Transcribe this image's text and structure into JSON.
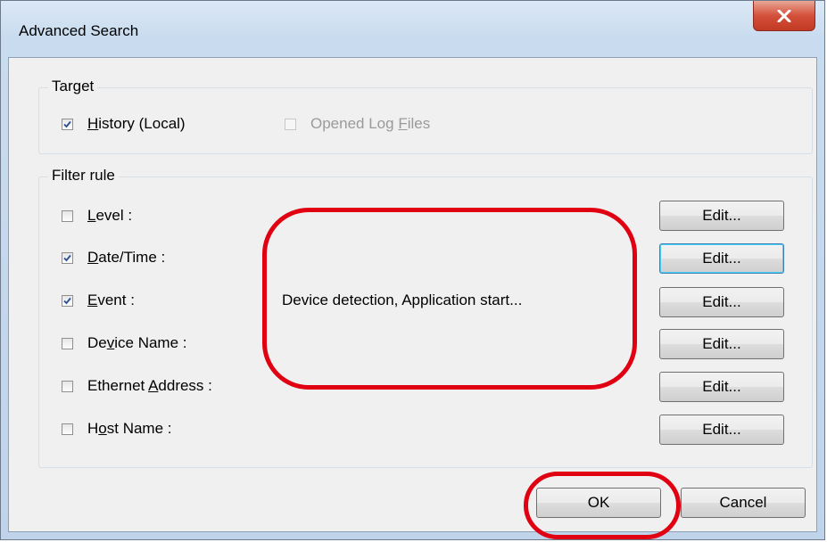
{
  "window": {
    "title": "Advanced Search"
  },
  "target": {
    "legend": "Target",
    "history": {
      "label_prefix": "",
      "label_key": "H",
      "label_suffix": "istory (Local)",
      "checked": true
    },
    "opened_logs": {
      "label_prefix": "Opened Log ",
      "label_key": "F",
      "label_suffix": "iles",
      "checked": false,
      "disabled": true
    }
  },
  "filter": {
    "legend": "Filter rule",
    "level": {
      "pre": "",
      "key": "L",
      "post": "evel :",
      "checked": false
    },
    "datetime": {
      "pre": "",
      "key": "D",
      "post": "ate/Time :",
      "checked": true
    },
    "event": {
      "pre": "",
      "key": "E",
      "post": "vent :",
      "checked": true
    },
    "device_name": {
      "pre": "De",
      "key": "v",
      "post": "ice Name :",
      "checked": false
    },
    "ethernet": {
      "pre": "Ethernet ",
      "key": "A",
      "post": "ddress :",
      "checked": false
    },
    "host": {
      "pre": "H",
      "key": "o",
      "post": "st Name :",
      "checked": false
    },
    "event_value": "Device detection, Application start...",
    "edit_label": "Edit..."
  },
  "buttons": {
    "ok": "OK",
    "cancel": "Cancel"
  },
  "colors": {
    "annotation": "#e00012",
    "close_button": "#c23a24"
  }
}
